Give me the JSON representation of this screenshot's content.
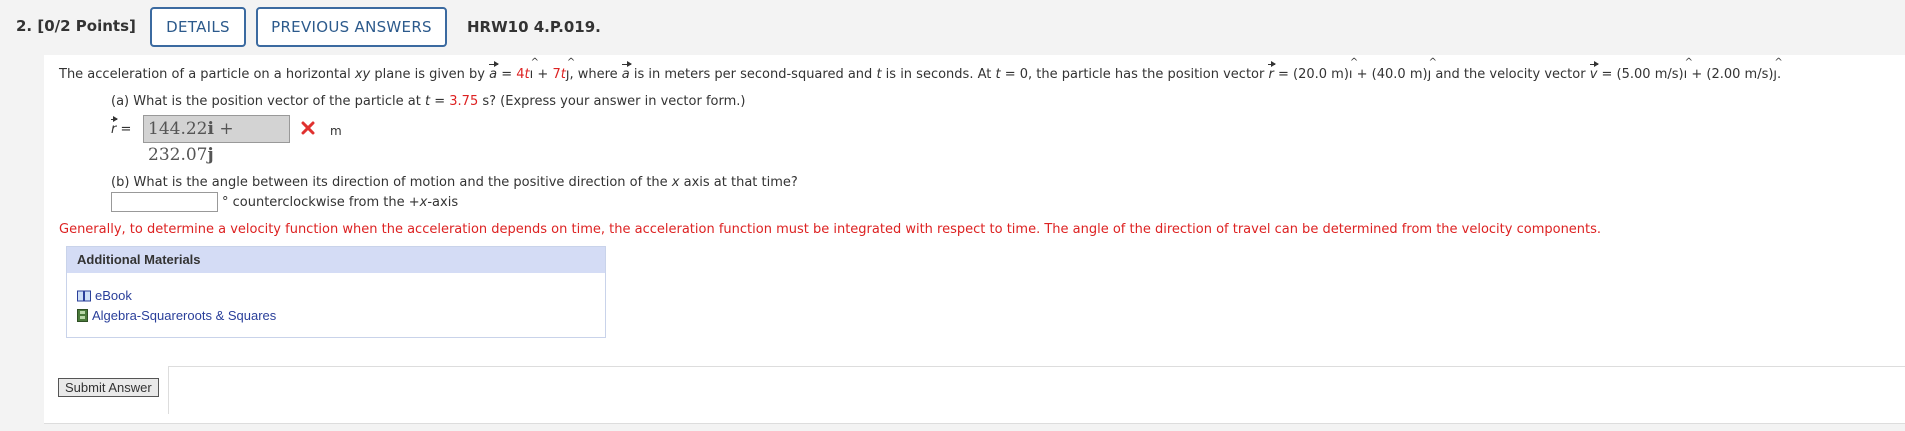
{
  "question": {
    "number": "2.",
    "points": "[0/2 Points]",
    "details_label": "DETAILS",
    "previous_answers_label": "PREVIOUS ANSWERS",
    "code": "HRW10 4.P.019."
  },
  "problem": {
    "p1": "The acceleration of a particle on a horizontal ",
    "xy": "xy",
    "p2": " plane is given by ",
    "a": "a",
    "eq": " = ",
    "coef1": "4",
    "t1": "t",
    "i1": "ı",
    "plus1": " + ",
    "coef2": "7",
    "t2": "t",
    "j1": "ȷ",
    "p3": ", where ",
    "a2": "a",
    "p4": " is in meters per second-squared and ",
    "t3": "t",
    "p5": " is in seconds. At ",
    "t4": "t",
    "p6": " = 0, the particle has the position vector ",
    "r": "r",
    "p7": " = (20.0 m)",
    "i2": "ı",
    "p8": " + (40.0 m)",
    "j2": "ȷ",
    "p9": " and the velocity vector ",
    "v": "v",
    "p10": " = (5.00 m/s)",
    "i3": "ı",
    "p11": " + (2.00 m/s)",
    "j3": "ȷ",
    "p12": "."
  },
  "part_a": {
    "q1": "(a) What is the position vector of the particle at ",
    "t": "t",
    "q2": " = ",
    "t_value": "3.75",
    "q3": " s? (Express your answer in vector form.)",
    "r": "r",
    "eq": " =",
    "answer_x": "144.22",
    "answer_i": "i",
    "answer_plus": " + 232.07",
    "answer_j": "j",
    "unit": "m",
    "status_icon": "incorrect-x-icon"
  },
  "part_b": {
    "q1": "(b) What is the angle between its direction of motion and the positive direction of the ",
    "x": "x",
    "q2": " axis at that time?",
    "input_value": "",
    "suffix1": "° counterclockwise from the +",
    "suffix_x": "x",
    "suffix2": "-axis"
  },
  "hint": "Generally, to determine a velocity function when the acceleration depends on time, the acceleration function must be integrated with respect to time. The angle of the direction of travel can be determined from the velocity components.",
  "additional_materials": {
    "title": "Additional Materials",
    "items": [
      {
        "label": "eBook",
        "icon": "book-icon"
      },
      {
        "label": "Algebra-Squareroots & Squares",
        "icon": "film-icon"
      }
    ]
  },
  "submit_label": "Submit Answer",
  "colors": {
    "accent_border": "#3b6aa0",
    "hint_red": "#dd2222",
    "materials_header": "#d4dcf5",
    "link_blue": "#2a3f9a"
  }
}
